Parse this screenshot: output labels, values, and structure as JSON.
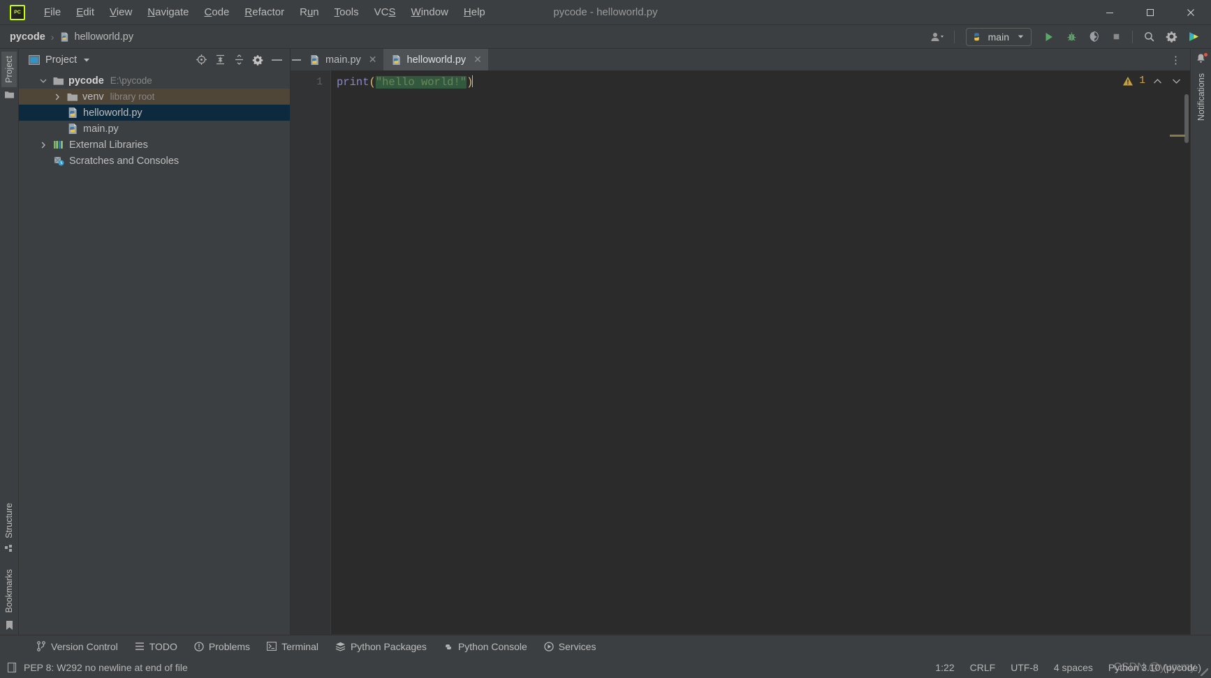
{
  "window": {
    "title": "pycode - helloworld.py",
    "logo_label": "PC",
    "minimize_label": "—",
    "maximize_label": "☐",
    "close_label": "✕"
  },
  "menu": [
    {
      "label": "File",
      "accel": "F"
    },
    {
      "label": "Edit",
      "accel": "E"
    },
    {
      "label": "View",
      "accel": "V"
    },
    {
      "label": "Navigate",
      "accel": "N"
    },
    {
      "label": "Code",
      "accel": "C"
    },
    {
      "label": "Refactor",
      "accel": "R"
    },
    {
      "label": "Run",
      "accel": "u"
    },
    {
      "label": "Tools",
      "accel": "T"
    },
    {
      "label": "VCS",
      "accel": "S"
    },
    {
      "label": "Window",
      "accel": "W"
    },
    {
      "label": "Help",
      "accel": "H"
    }
  ],
  "navbar": {
    "crumbs": [
      "pycode",
      "helloworld.py"
    ],
    "separator": "›",
    "run_config": "main",
    "icons": [
      "user-avatar-icon",
      "run-icon",
      "debug-icon",
      "coverage-icon",
      "stop-icon",
      "search-icon",
      "settings-icon",
      "ai-assistant-icon"
    ]
  },
  "left_strip": {
    "top": [
      {
        "label": "Project",
        "icon": "folder-icon",
        "active": true
      }
    ],
    "bottom": [
      {
        "label": "Structure",
        "icon": "structure-icon"
      },
      {
        "label": "Bookmarks",
        "icon": "bookmark-icon"
      }
    ]
  },
  "right_strip": {
    "items": [
      {
        "label": "Notifications",
        "icon": "bell-icon",
        "badge": true
      }
    ]
  },
  "project_panel": {
    "title": "Project",
    "chevron": "▾",
    "icons": [
      "locate-icon",
      "expand-all-icon",
      "collapse-all-icon",
      "settings-icon",
      "hide-icon"
    ],
    "tree": [
      {
        "label": "pycode",
        "sub": "E:\\pycode",
        "arrow": "⌄",
        "icon": "folder-icon",
        "indent": 0,
        "bold": true,
        "state": "normal"
      },
      {
        "label": "venv",
        "sub": "library root",
        "arrow": "›",
        "icon": "folder-icon",
        "indent": 1,
        "bold": false,
        "state": "hover"
      },
      {
        "label": "helloworld.py",
        "sub": "",
        "arrow": "",
        "icon": "python-file-icon",
        "indent": 2,
        "bold": false,
        "state": "selected"
      },
      {
        "label": "main.py",
        "sub": "",
        "arrow": "",
        "icon": "python-file-icon",
        "indent": 2,
        "bold": false,
        "state": "normal"
      },
      {
        "label": "External Libraries",
        "sub": "",
        "arrow": "›",
        "icon": "library-icon",
        "indent": 0,
        "bold": false,
        "state": "normal"
      },
      {
        "label": "Scratches and Consoles",
        "sub": "",
        "arrow": "",
        "icon": "scratches-icon",
        "indent": 0,
        "bold": false,
        "state": "normal"
      }
    ]
  },
  "editor": {
    "tabs": [
      {
        "label": "main.py",
        "icon": "python-file-icon",
        "active": false,
        "close": "✕"
      },
      {
        "label": "helloworld.py",
        "icon": "python-file-icon",
        "active": true,
        "close": "✕"
      }
    ],
    "options_icon": "⋮",
    "line_numbers": [
      "1"
    ],
    "code": {
      "func": "print",
      "open_paren": "(",
      "string": "\"hello world!\"",
      "close_paren": ")"
    },
    "inspection": {
      "warning_icon": "warning-triangle-icon",
      "warning_count": "1",
      "prev": "⌃",
      "next": "⌄"
    }
  },
  "tool_windows": [
    {
      "label": "Version Control",
      "icon": "branch-icon"
    },
    {
      "label": "TODO",
      "icon": "list-icon"
    },
    {
      "label": "Problems",
      "icon": "problems-icon"
    },
    {
      "label": "Terminal",
      "icon": "terminal-icon"
    },
    {
      "label": "Python Packages",
      "icon": "packages-icon"
    },
    {
      "label": "Python Console",
      "icon": "python-icon"
    },
    {
      "label": "Services",
      "icon": "services-icon"
    }
  ],
  "status_bar": {
    "message_icon": "file-icon",
    "message": "PEP 8: W292 no newline at end of file",
    "caret_position": "1:22",
    "line_separator": "CRLF",
    "encoding": "UTF-8",
    "indent": "4 spaces",
    "interpreter": "Python 3.10 (pycode)"
  },
  "watermark": "CSDN @yummy",
  "colors": {
    "background": "#3c3f41",
    "editor_background": "#2b2b2b",
    "selection": "#0d293e",
    "hover_row": "#4f4637",
    "keyword": "#8888c6",
    "string": "#6a8759",
    "string_highlight": "#32593d",
    "paren": "#e0c16b",
    "warning": "#cfa54a",
    "run_green": "#59a869",
    "badge_red": "#e5573f"
  }
}
